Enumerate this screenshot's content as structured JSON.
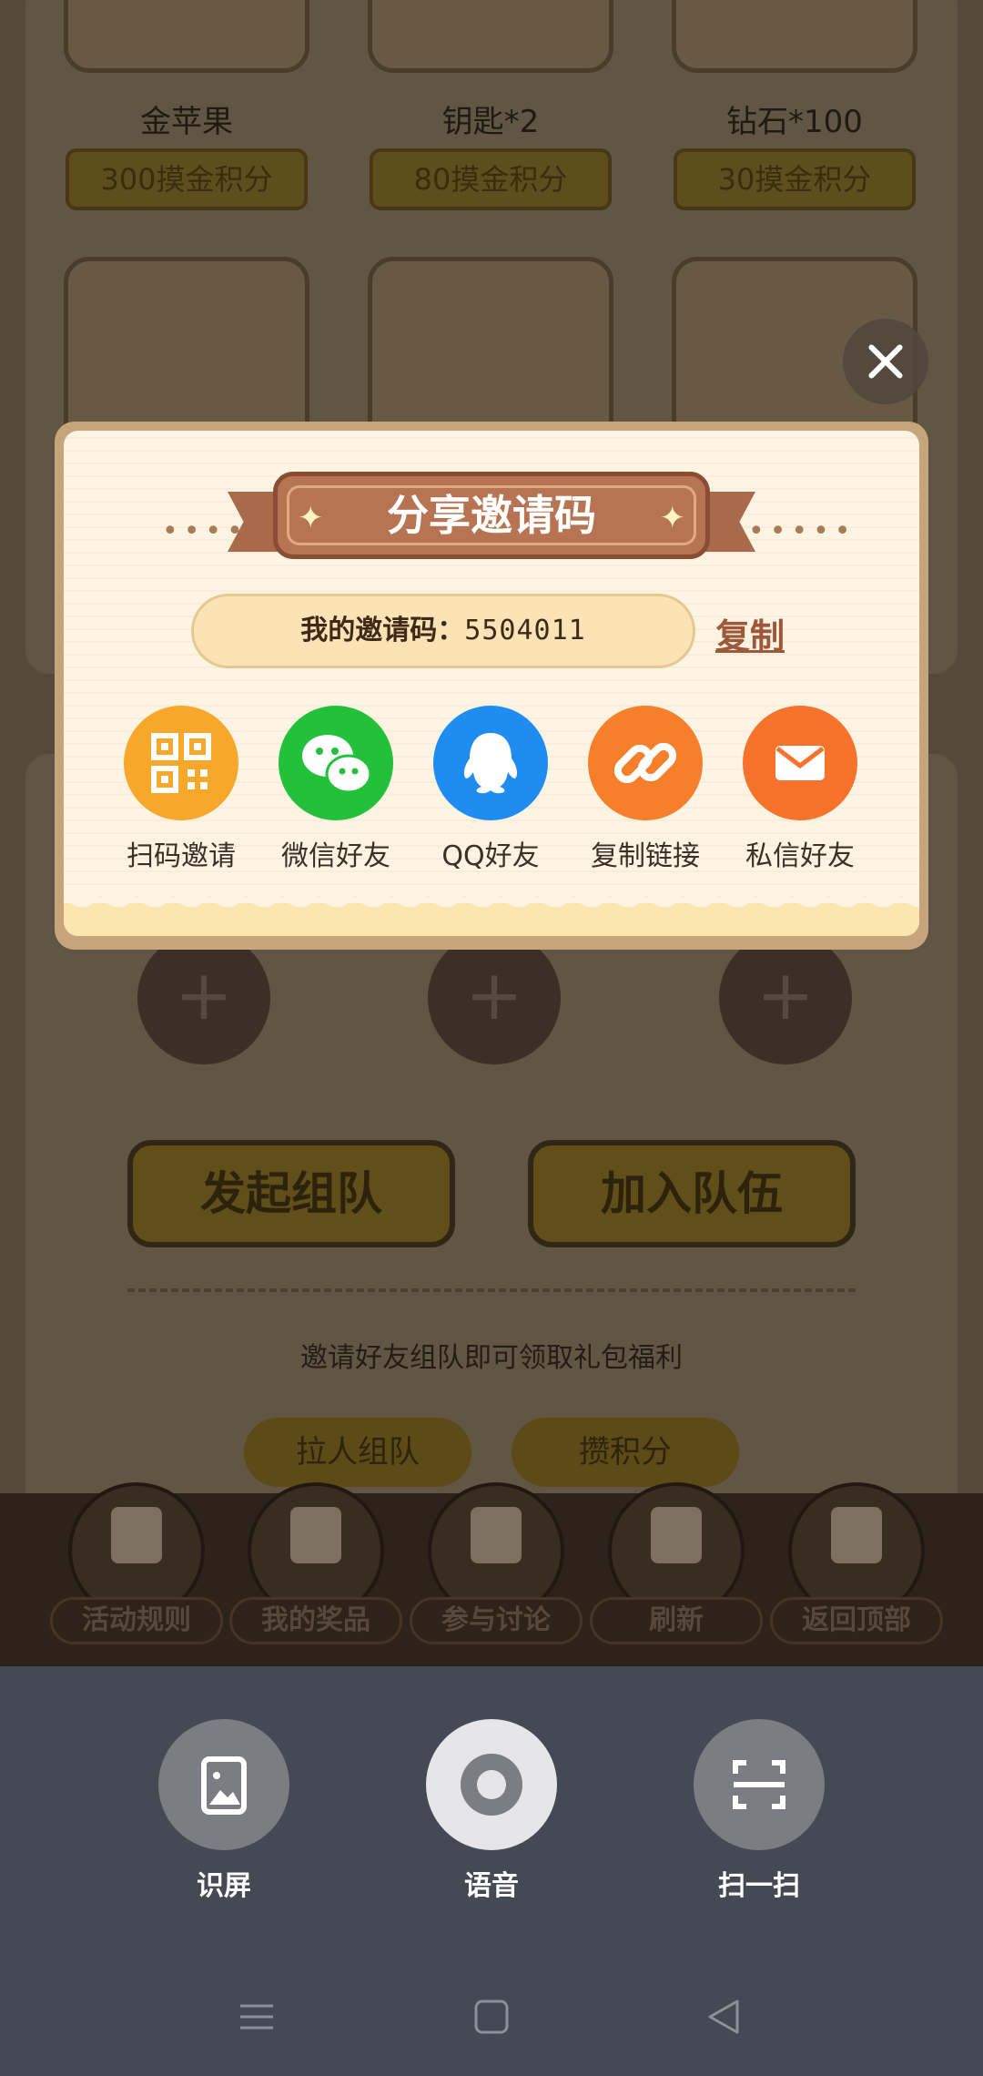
{
  "prizes_row1": [
    {
      "name": "金苹果",
      "cost": "300摸金积分"
    },
    {
      "name": "钥匙*2",
      "cost": "80摸金积分"
    },
    {
      "name": "钻石*100",
      "cost": "30摸金积分"
    }
  ],
  "team_actions": {
    "start_team": "发起组队",
    "join_team": "加入队伍"
  },
  "invite_hint": "邀请好友组队即可领取礼包福利",
  "tabs": [
    "拉人组队",
    "攒积分"
  ],
  "bottom_nav": [
    "活动规则",
    "我的奖品",
    "参与讨论",
    "刷新",
    "返回顶部"
  ],
  "dialog": {
    "title": "分享邀请码",
    "invite_label": "我的邀请码：",
    "invite_code": "5504011",
    "copy_label": "复制",
    "share_options": [
      {
        "label": "扫码邀请",
        "icon": "qr-code-icon",
        "color": "#f7a72a"
      },
      {
        "label": "微信好友",
        "icon": "wechat-icon",
        "color": "#23c13a"
      },
      {
        "label": "QQ好友",
        "icon": "qq-icon",
        "color": "#1f8cf2"
      },
      {
        "label": "复制链接",
        "icon": "link-icon",
        "color": "#f77f2b"
      },
      {
        "label": "私信好友",
        "icon": "mail-icon",
        "color": "#f7732b"
      }
    ]
  },
  "system_sheet": {
    "buttons": [
      {
        "label": "识屏",
        "icon": "screen-recognize-icon"
      },
      {
        "label": "语音",
        "icon": "voice-icon"
      },
      {
        "label": "扫一扫",
        "icon": "scan-icon"
      }
    ]
  }
}
